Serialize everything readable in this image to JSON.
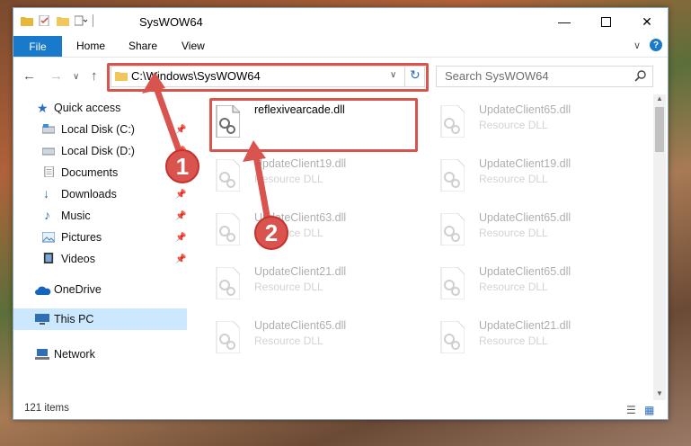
{
  "window": {
    "title": "SysWOW64"
  },
  "ribbon": {
    "file_label": "File",
    "tabs": [
      "Home",
      "Share",
      "View"
    ]
  },
  "address": {
    "path": "C:\\Windows\\SysWOW64"
  },
  "search": {
    "placeholder": "Search SysWOW64"
  },
  "sidebar": {
    "items": [
      {
        "label": "Quick access"
      },
      {
        "label": "Local Disk (C:)"
      },
      {
        "label": "Local Disk (D:)"
      },
      {
        "label": "Documents"
      },
      {
        "label": "Downloads"
      },
      {
        "label": "Music"
      },
      {
        "label": "Pictures"
      },
      {
        "label": "Videos"
      },
      {
        "label": "OneDrive"
      },
      {
        "label": "This PC"
      },
      {
        "label": "Network"
      }
    ]
  },
  "files": [
    {
      "name": "reflexivearcade.dll",
      "type": ""
    },
    {
      "name": "UpdateClient65.dll",
      "type": "Resource DLL"
    },
    {
      "name": "UpdateClient19.dll",
      "type": "Resource DLL"
    },
    {
      "name": "UpdateClient19.dll",
      "type": "Resource DLL"
    },
    {
      "name": "UpdateClient63.dll",
      "type": "Resource DLL"
    },
    {
      "name": "UpdateClient65.dll",
      "type": "Resource DLL"
    },
    {
      "name": "UpdateClient21.dll",
      "type": "Resource DLL"
    },
    {
      "name": "UpdateClient65.dll",
      "type": "Resource DLL"
    },
    {
      "name": "UpdateClient65.dll",
      "type": "Resource DLL"
    },
    {
      "name": "UpdateClient21.dll",
      "type": "Resource DLL"
    }
  ],
  "status": {
    "count": "121 items"
  },
  "annotations": {
    "step1": "1",
    "step2": "2"
  },
  "colors": {
    "accent": "#1979ca",
    "highlight": "#d9534f"
  }
}
